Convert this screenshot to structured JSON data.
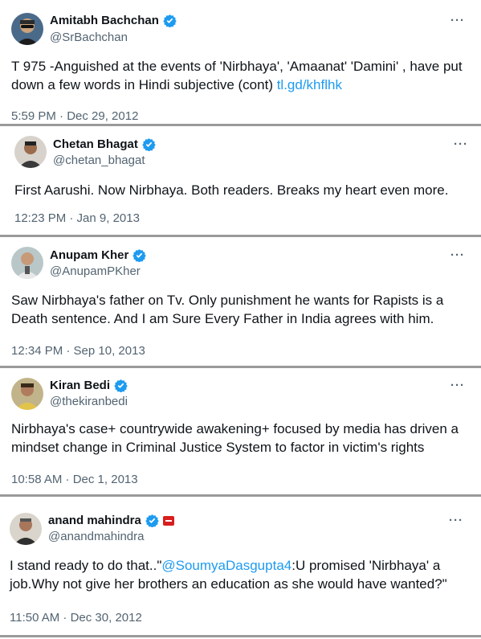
{
  "colors": {
    "verified": "#1d9bf0",
    "link": "#1d9bf0",
    "muted": "#536471",
    "text": "#0f1419",
    "affiliate_badge": "#d81e1e"
  },
  "icons": {
    "verified": "verified-badge-icon",
    "more": "more-options-icon",
    "affiliate": "affiliate-badge-icon"
  },
  "tweets": [
    {
      "name": "Amitabh Bachchan",
      "handle": "@SrBachchan",
      "text_before": "T 975 -Anguished at the events of 'Nirbhaya', 'Amaanat' 'Damini' , have put down a few words in Hindi subjective (cont) ",
      "link": "tl.gd/khflhk",
      "time": "5:59 PM · Dec 29, 2012",
      "more": "···"
    },
    {
      "name": "Chetan Bhagat",
      "handle": "@chetan_bhagat",
      "text": "First Aarushi. Now Nirbhaya. Both readers. Breaks my heart even more.",
      "time": "12:23 PM · Jan 9, 2013",
      "more": "···"
    },
    {
      "name": "Anupam Kher",
      "handle": "@AnupamPKher",
      "text": "Saw Nirbhaya's father on Tv. Only punishment he wants for Rapists is a Death sentence. And I am Sure Every Father in India agrees with him.",
      "time": "12:34 PM · Sep 10, 2013",
      "more": "···"
    },
    {
      "name": "Kiran Bedi",
      "handle": "@thekiranbedi",
      "text": "Nirbhaya's case+ countrywide awakening+ focused by media has driven a mindset change in Criminal Justice System to factor in victim's rights",
      "time": "10:58 AM · Dec 1, 2013",
      "more": "···"
    },
    {
      "name": "anand mahindra",
      "handle": "@anandmahindra",
      "text_before": "I stand ready to do that..\"",
      "mention": "@SoumyaDasgupta4",
      "text_after": ":U promised 'Nirbhaya' a job.Why not give her brothers an education as she would have wanted?\"",
      "time": "11:50 AM · Dec 30, 2012",
      "more": "···"
    }
  ]
}
